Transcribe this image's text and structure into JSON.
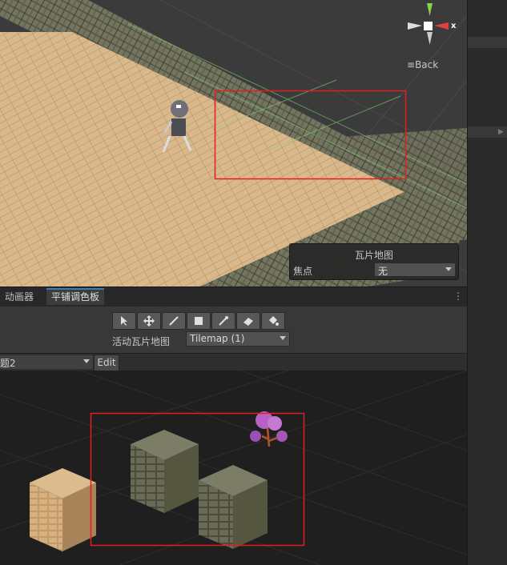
{
  "scene": {
    "gizmo_axis_label": "x",
    "back_label": "Back",
    "tilemap_overlay": {
      "title": "瓦片地图",
      "focus_label": "焦点",
      "focus_value": "无"
    }
  },
  "tabs": [
    {
      "label": "动画器",
      "active": false
    },
    {
      "label": "平铺调色板",
      "active": true
    }
  ],
  "tile_palette": {
    "tools": [
      {
        "name": "select-tool",
        "icon": "arrow-icon"
      },
      {
        "name": "move-tool",
        "icon": "move-icon"
      },
      {
        "name": "paint-tool",
        "icon": "brush-icon"
      },
      {
        "name": "box-fill-tool",
        "icon": "rectangle-icon"
      },
      {
        "name": "pick-tool",
        "icon": "eyedropper-icon"
      },
      {
        "name": "erase-tool",
        "icon": "eraser-icon"
      },
      {
        "name": "fill-tool",
        "icon": "bucket-icon"
      }
    ],
    "active_tilemap_label": "活动瓦片地图",
    "active_tilemap_value": "Tilemap (1)",
    "palette_name": "题2",
    "edit_label": "Edit"
  },
  "colors": {
    "selection_outline": "#e02020",
    "accent_tab": "#3a79bb",
    "sand_tile": "#d8b88a",
    "stone_tile": "#5f6050",
    "flower": "#b060c0"
  }
}
